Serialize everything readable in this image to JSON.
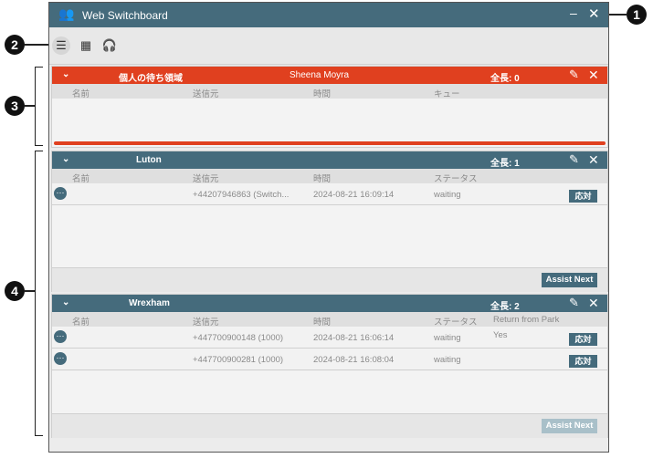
{
  "window": {
    "title": "Web Switchboard",
    "app_icon": "people-icon",
    "minimize": "–",
    "close": "✕"
  },
  "toolbar": {
    "list_view_icon": "list-icon",
    "grid_view_icon": "grid-icon",
    "headset_icon": "headset-icon"
  },
  "callouts": [
    "1",
    "2",
    "3",
    "4"
  ],
  "colors": {
    "header_blue": "#456b7c",
    "personal_red": "#e0401f"
  },
  "queues": [
    {
      "name": "個人の待ち領域",
      "agent": "Sheena Moyra",
      "total": "全長: 0",
      "columns": [
        "名前",
        "送信元",
        "時間",
        "キュー"
      ],
      "rows": []
    },
    {
      "name": "Luton",
      "total": "全長: 1",
      "columns": [
        "名前",
        "送信元",
        "時間",
        "ステータス"
      ],
      "rows": [
        {
          "from": "+44207946863 (Switch...",
          "time": "2024-08-21 16:09:14",
          "status": "waiting",
          "answer": "応対"
        }
      ],
      "assist_next": "Assist Next"
    },
    {
      "name": "Wrexham",
      "total": "全長: 2",
      "columns": [
        "名前",
        "送信元",
        "時間",
        "ステータス",
        "Return from Park"
      ],
      "rows": [
        {
          "from": "+447700900148 (1000)",
          "time": "2024-08-21 16:06:14",
          "status": "waiting",
          "park": "Yes",
          "answer": "応対"
        },
        {
          "from": "+447700900281 (1000)",
          "time": "2024-08-21 16:08:04",
          "status": "waiting",
          "park": "",
          "answer": "応対"
        }
      ],
      "assist_next": "Assist Next"
    }
  ],
  "icons": {
    "edit": "✎",
    "close": "✕",
    "chevron": "⌄",
    "more": "⋯"
  }
}
